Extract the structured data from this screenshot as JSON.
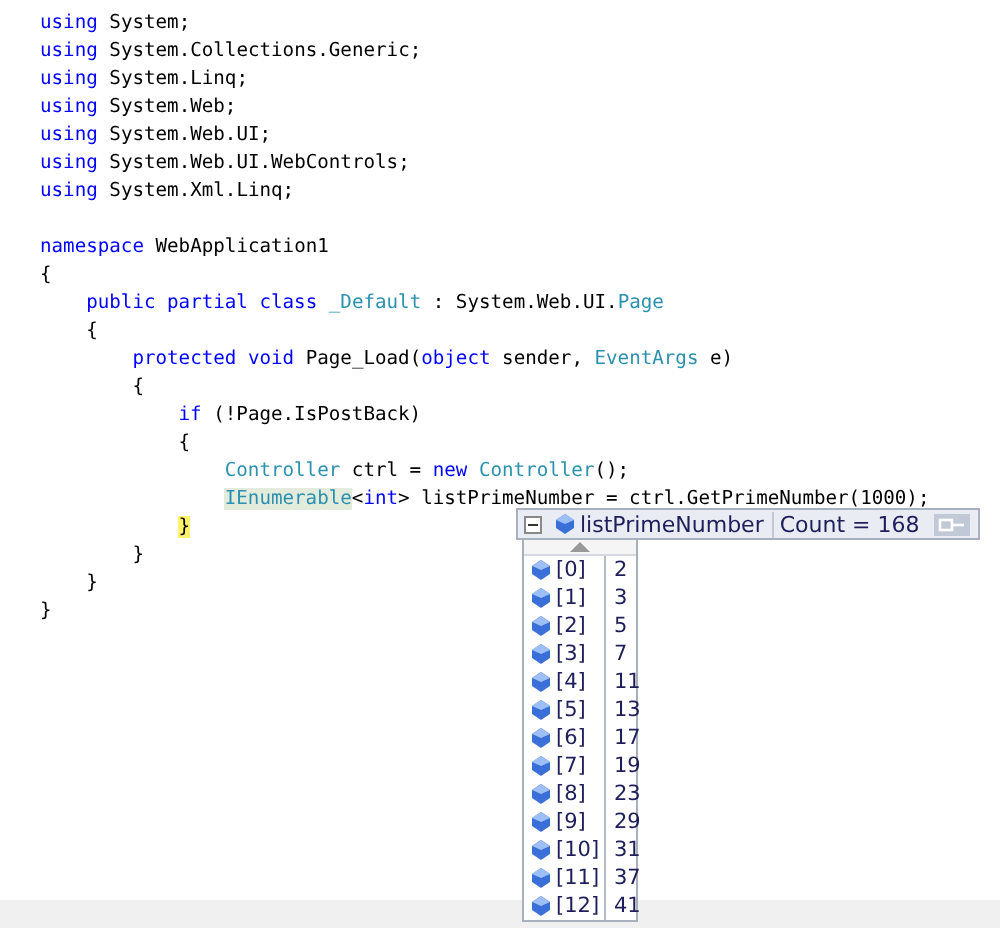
{
  "using_lines": [
    [
      {
        "text": "using",
        "kind": "keyword"
      },
      {
        "text": " System;",
        "kind": "plain"
      }
    ],
    [
      {
        "text": "using",
        "kind": "keyword"
      },
      {
        "text": " System.Collections.Generic;",
        "kind": "plain"
      }
    ],
    [
      {
        "text": "using",
        "kind": "keyword"
      },
      {
        "text": " System.Linq;",
        "kind": "plain"
      }
    ],
    [
      {
        "text": "using",
        "kind": "keyword"
      },
      {
        "text": " System.Web;",
        "kind": "plain"
      }
    ],
    [
      {
        "text": "using",
        "kind": "keyword"
      },
      {
        "text": " System.Web.UI;",
        "kind": "plain"
      }
    ],
    [
      {
        "text": "using",
        "kind": "keyword"
      },
      {
        "text": " System.Web.UI.WebControls;",
        "kind": "plain"
      }
    ],
    [
      {
        "text": "using",
        "kind": "keyword"
      },
      {
        "text": " System.Xml.Linq;",
        "kind": "plain"
      }
    ]
  ],
  "namespace_block": {
    "header": [
      {
        "text": "namespace",
        "kind": "keyword"
      },
      {
        "text": " WebApplication1",
        "kind": "plain"
      }
    ],
    "open": [
      {
        "text": "{",
        "kind": "plain"
      }
    ],
    "close": [
      {
        "text": "}",
        "kind": "plain"
      }
    ],
    "children": [
      {
        "header": [
          {
            "text": "public partial class",
            "kind": "keyword"
          },
          {
            "text": " _Default",
            "kind": "type"
          },
          {
            "text": " : System.Web.UI.",
            "kind": "plain"
          },
          {
            "text": "Page",
            "kind": "type"
          }
        ],
        "open": [
          {
            "text": "{",
            "kind": "plain"
          }
        ],
        "close": [
          {
            "text": "}",
            "kind": "plain"
          }
        ],
        "children": [
          {
            "header": [
              {
                "text": "protected void",
                "kind": "keyword"
              },
              {
                "text": " Page_Load(",
                "kind": "plain"
              },
              {
                "text": "object",
                "kind": "keyword"
              },
              {
                "text": " sender, ",
                "kind": "plain"
              },
              {
                "text": "EventArgs",
                "kind": "type"
              },
              {
                "text": " e)",
                "kind": "plain"
              }
            ],
            "open": [
              {
                "text": "{",
                "kind": "plain"
              }
            ],
            "close": [
              {
                "text": "}",
                "kind": "plain"
              }
            ],
            "children": [
              {
                "header": [
                  {
                    "text": "if",
                    "kind": "keyword"
                  },
                  {
                    "text": " (!Page.IsPostBack)",
                    "kind": "plain"
                  }
                ],
                "open": [
                  {
                    "text": "{",
                    "kind": "plain"
                  }
                ],
                "close": [
                  {
                    "text": "}",
                    "kind": "current"
                  }
                ],
                "children": [
                  {
                    "header": [
                      {
                        "text": "Controller",
                        "kind": "type"
                      },
                      {
                        "text": " ctrl = ",
                        "kind": "plain"
                      },
                      {
                        "text": "new",
                        "kind": "keyword"
                      },
                      {
                        "text": " Controller",
                        "kind": "type"
                      },
                      {
                        "text": "();",
                        "kind": "plain"
                      }
                    ]
                  },
                  {
                    "header": [
                      {
                        "text": "IEnumerable",
                        "kind": "type-highlight"
                      },
                      {
                        "text": "<",
                        "kind": "plain"
                      },
                      {
                        "text": "int",
                        "kind": "keyword"
                      },
                      {
                        "text": "> listPrimeNumber = ctrl.GetPrimeNumber(1000);",
                        "kind": "plain"
                      }
                    ]
                  }
                ]
              }
            ]
          }
        ]
      }
    ]
  },
  "datatip": {
    "expanded": true,
    "name": "listPrimeNumber",
    "value": "Count = 168",
    "items": [
      {
        "index": "[0]",
        "value": "2"
      },
      {
        "index": "[1]",
        "value": "3"
      },
      {
        "index": "[2]",
        "value": "5"
      },
      {
        "index": "[3]",
        "value": "7"
      },
      {
        "index": "[4]",
        "value": "11"
      },
      {
        "index": "[5]",
        "value": "13"
      },
      {
        "index": "[6]",
        "value": "17"
      },
      {
        "index": "[7]",
        "value": "19"
      },
      {
        "index": "[8]",
        "value": "23"
      },
      {
        "index": "[9]",
        "value": "29"
      },
      {
        "index": "[10]",
        "value": "31"
      },
      {
        "index": "[11]",
        "value": "37"
      },
      {
        "index": "[12]",
        "value": "41"
      }
    ]
  }
}
